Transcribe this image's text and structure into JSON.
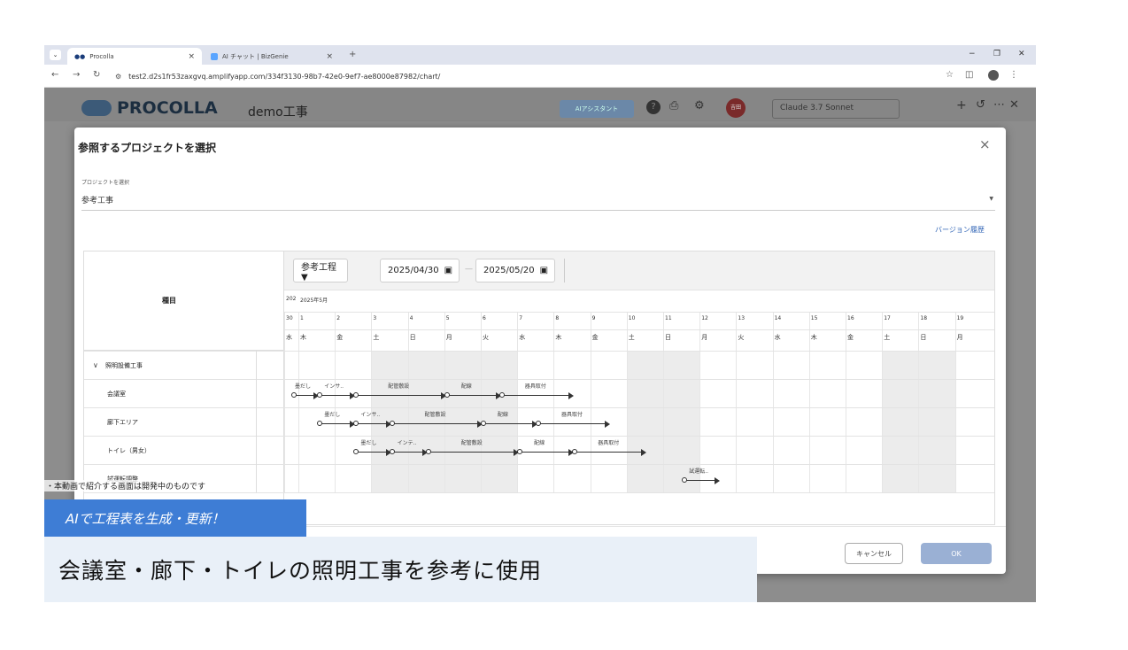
{
  "browser": {
    "tabs": [
      {
        "label": "Procolla"
      },
      {
        "label": "AI チャット | BizGenie"
      }
    ],
    "new_tab": "+",
    "url": "test2.d2s1fr53zaxgvq.amplifyapp.com/334f3130-98b7-42e0-9ef7-ae8000e87982/chart/",
    "window_controls": [
      "−",
      "❐",
      "✕"
    ]
  },
  "app": {
    "logo": "PROCOLLA",
    "project": "demo工事",
    "ai_button": "AIアシスタント",
    "user": "吉田",
    "model": "Claude 3.7 Sonnet"
  },
  "modal": {
    "title": "参照するプロジェクトを選択",
    "close": "×",
    "select_label": "プロジェクトを選択",
    "select_value": "参考工事",
    "version_link": "バージョン履歴",
    "category_header": "種目",
    "schedule_select": "参考工程 ▼",
    "date_from": "2025/04/30",
    "date_to": "2025/05/20",
    "date_sep": "—",
    "year_month_prev": "202",
    "year_month": "2025年5月",
    "days": [
      {
        "d": "30",
        "w": "水",
        "off": false
      },
      {
        "d": "1",
        "w": "木",
        "off": false
      },
      {
        "d": "2",
        "w": "金",
        "off": false
      },
      {
        "d": "3",
        "w": "土",
        "off": true
      },
      {
        "d": "4",
        "w": "日",
        "off": true
      },
      {
        "d": "5",
        "w": "月",
        "off": true
      },
      {
        "d": "6",
        "w": "火",
        "off": true
      },
      {
        "d": "7",
        "w": "水",
        "off": false
      },
      {
        "d": "8",
        "w": "木",
        "off": false
      },
      {
        "d": "9",
        "w": "金",
        "off": false
      },
      {
        "d": "10",
        "w": "土",
        "off": true
      },
      {
        "d": "11",
        "w": "日",
        "off": true
      },
      {
        "d": "12",
        "w": "月",
        "off": false
      },
      {
        "d": "13",
        "w": "火",
        "off": false
      },
      {
        "d": "14",
        "w": "水",
        "off": false
      },
      {
        "d": "15",
        "w": "木",
        "off": false
      },
      {
        "d": "16",
        "w": "金",
        "off": false
      },
      {
        "d": "17",
        "w": "土",
        "off": true
      },
      {
        "d": "18",
        "w": "日",
        "off": true
      },
      {
        "d": "19",
        "w": "月",
        "off": false
      }
    ],
    "group": {
      "expand": "∨",
      "label": "照明設備工事"
    },
    "rows": [
      {
        "label": "会議室",
        "tasks": [
          {
            "label": "墨だし",
            "start": 0.5,
            "end": 1.5
          },
          {
            "label": "インサ..",
            "start": 1.5,
            "end": 2.5
          },
          {
            "label": "配管敷設",
            "start": 2.5,
            "end": 5
          },
          {
            "label": "配線",
            "start": 5,
            "end": 6.5
          },
          {
            "label": "器具取付",
            "start": 6.5,
            "end": 8.5
          }
        ]
      },
      {
        "label": "廊下エリア",
        "tasks": [
          {
            "label": "墨だし",
            "start": 1.5,
            "end": 2.5
          },
          {
            "label": "インサ..",
            "start": 2.5,
            "end": 3.5
          },
          {
            "label": "配管敷設",
            "start": 3.5,
            "end": 6
          },
          {
            "label": "配線",
            "start": 6,
            "end": 7.5
          },
          {
            "label": "器具取付",
            "start": 7.5,
            "end": 9.5
          }
        ]
      },
      {
        "label": "トイレ（男女）",
        "tasks": [
          {
            "label": "墨だし",
            "start": 2.5,
            "end": 3.5
          },
          {
            "label": "インテ..",
            "start": 3.5,
            "end": 4.5
          },
          {
            "label": "配管敷設",
            "start": 4.5,
            "end": 7
          },
          {
            "label": "配線",
            "start": 7,
            "end": 8.5
          },
          {
            "label": "器具取付",
            "start": 8.5,
            "end": 10.5
          }
        ]
      },
      {
        "label": "試運転調整",
        "tasks": [
          {
            "label": "試運転..",
            "start": 11.5,
            "end": 12.5
          }
        ]
      }
    ],
    "cancel": "キャンセル",
    "ok": "OK"
  },
  "overlay": {
    "note": "・本動画で紹介する画面は開発中のものです",
    "tag": "AIで工程表を生成・更新！",
    "caption": "会議室・廊下・トイレの照明工事を参考に使用"
  },
  "colors": {
    "accent": "#3e7dd5",
    "ok_button": "#9ab0d4",
    "brand": "#1a3c7a"
  }
}
